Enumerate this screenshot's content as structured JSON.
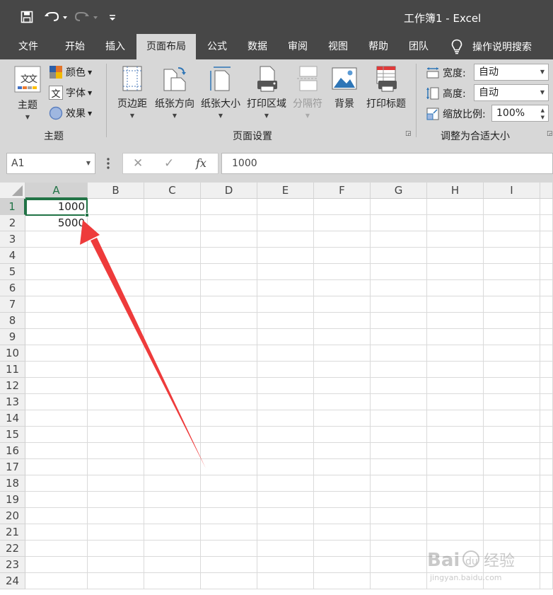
{
  "window": {
    "title": "工作簿1  -  Excel"
  },
  "quick_access": {
    "save_icon": "save-icon",
    "undo_icon": "undo-icon",
    "redo_icon": "redo-icon",
    "customize_icon": "customize-qat-icon"
  },
  "tabs": [
    {
      "label": "文件"
    },
    {
      "label": "开始"
    },
    {
      "label": "插入"
    },
    {
      "label": "页面布局",
      "active": true
    },
    {
      "label": "公式"
    },
    {
      "label": "数据"
    },
    {
      "label": "审阅"
    },
    {
      "label": "视图"
    },
    {
      "label": "帮助"
    },
    {
      "label": "团队"
    }
  ],
  "tell_me": {
    "label": "操作说明搜索",
    "icon": "lightbulb-icon"
  },
  "ribbon": {
    "themes": {
      "group_label": "主题",
      "theme_button": "主题",
      "colors": "颜色",
      "fonts": "字体",
      "effects": "效果",
      "font_icon_glyph": "文"
    },
    "page_setup": {
      "group_label": "页面设置",
      "margins": "页边距",
      "orientation": "纸张方向",
      "size": "纸张大小",
      "print_area": "打印区域",
      "breaks": "分隔符",
      "background": "背景",
      "print_titles": "打印标题"
    },
    "scale_to_fit": {
      "group_label": "调整为合适大小",
      "width_label": "宽度:",
      "width_value": "自动",
      "height_label": "高度:",
      "height_value": "自动",
      "scale_label": "缩放比例:",
      "scale_value": "100%"
    }
  },
  "formula_bar": {
    "name_box": "A1",
    "cancel": "✕",
    "enter": "✓",
    "fx": "fx",
    "value": "1000"
  },
  "sheet": {
    "columns": [
      "A",
      "B",
      "C",
      "D",
      "E",
      "F",
      "G",
      "H",
      "I"
    ],
    "rows": [
      "1",
      "2",
      "3",
      "4",
      "5",
      "6",
      "7",
      "8",
      "9",
      "10",
      "11",
      "12",
      "13",
      "14",
      "15",
      "16",
      "17",
      "18",
      "19",
      "20",
      "21",
      "22",
      "23",
      "24"
    ],
    "cells": {
      "A1": "1000",
      "A2": "5000"
    },
    "selected_cell": "A1"
  },
  "annotation": {
    "arrow_color": "#ee3b3b"
  },
  "colors": {
    "accent_green": "#217346",
    "chrome_dark": "#474747",
    "ribbon_gray": "#d7d7d7"
  }
}
